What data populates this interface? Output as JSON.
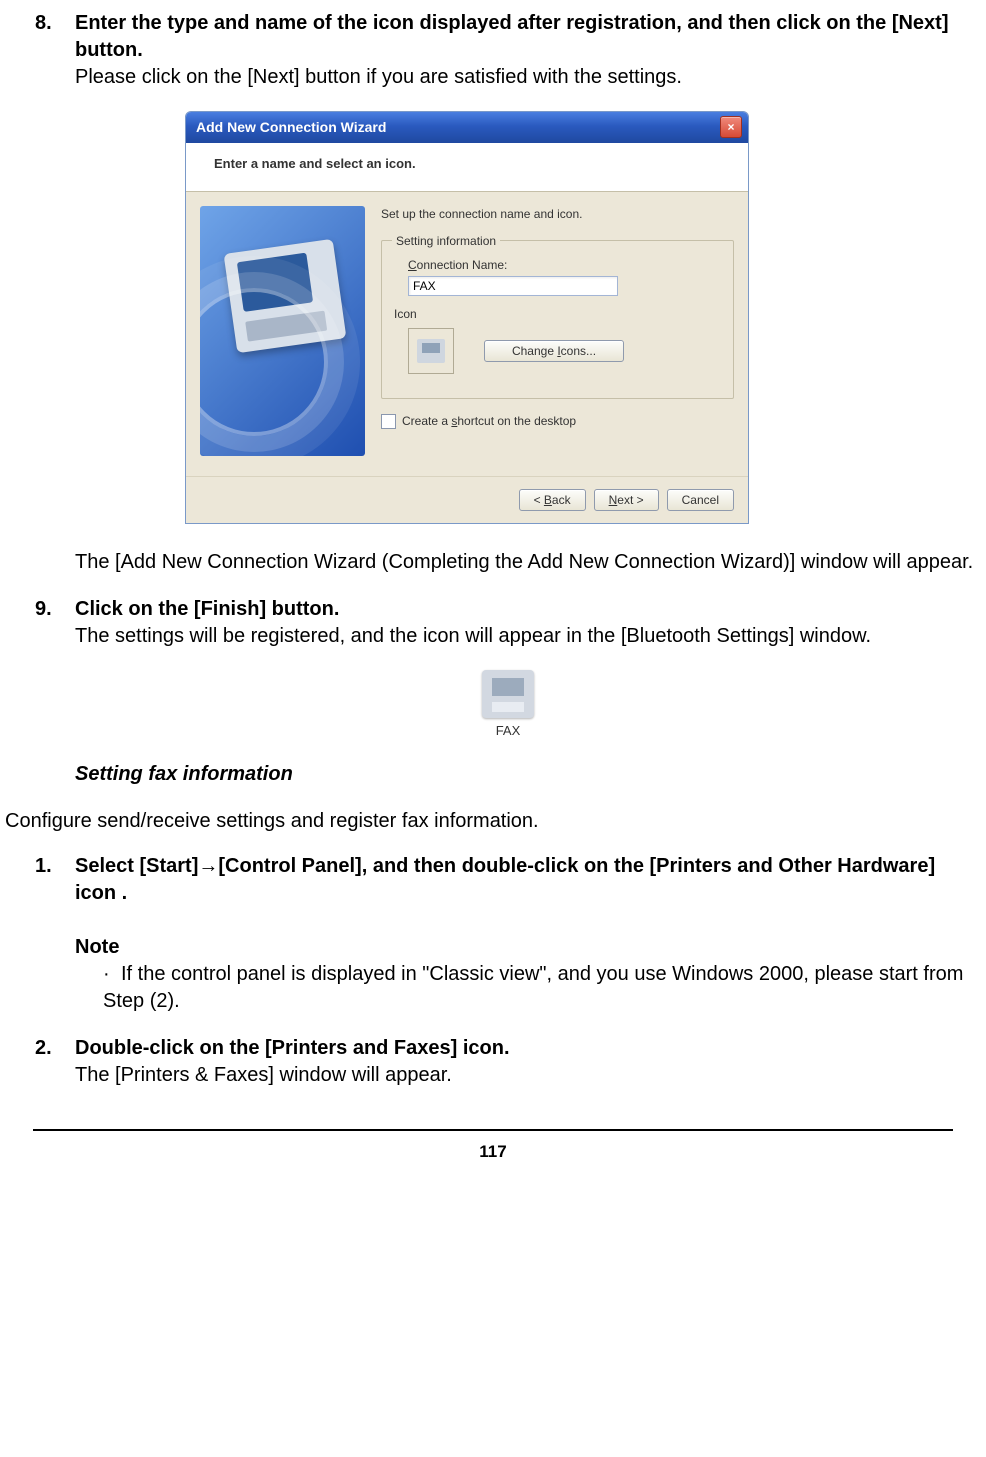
{
  "step8": {
    "num": "8.",
    "title": "Enter the type and name of the icon displayed after registration, and then click on the [Next] button.",
    "body": "Please click on the [Next] button if you are satisfied with the settings."
  },
  "dialog": {
    "title": "Add New Connection Wizard",
    "banner": "Enter a name and select an icon.",
    "prompt": "Set up the connection name and icon.",
    "group_legend": "Setting information",
    "conn_label": "Connection Name:",
    "conn_value": "FAX",
    "icon_label": "Icon",
    "change_icons": "Change Icons...",
    "shortcut": "Create a shortcut on the desktop",
    "back": "< Back",
    "next": "Next >",
    "cancel": "Cancel"
  },
  "post8": "The [Add New Connection Wizard (Completing the Add New Connection Wizard)] window will appear.",
  "step9": {
    "num": "9.",
    "title": "Click on the [Finish] button.",
    "body": "The settings will be registered, and the icon will appear in the [Bluetooth Settings] window."
  },
  "fax_icon_label": "FAX",
  "section_heading": "Setting fax information",
  "section_intro": "Configure send/receive settings and register fax information.",
  "step1": {
    "num": "1.",
    "title_a": "Select [Start]",
    "title_b": "[Control Panel], and then double-click on the [Printers and Other Hardware] icon .",
    "note_label": "Note",
    "note_body": "If the control panel is displayed in \"Classic view\", and you use Windows 2000, please start from Step (2)."
  },
  "step2": {
    "num": "2.",
    "title": "Double-click on the [Printers and Faxes] icon.",
    "body": "The [Printers & Faxes] window will appear."
  },
  "page_number": "117"
}
